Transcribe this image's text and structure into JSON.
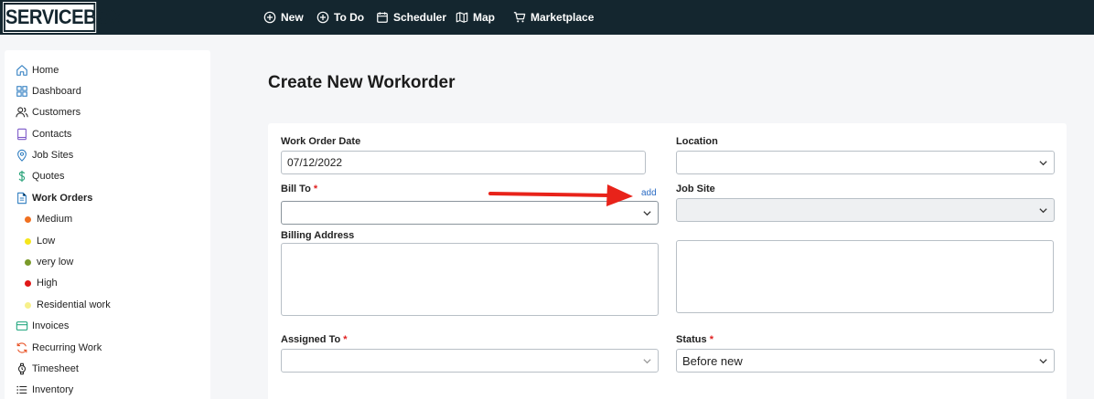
{
  "app": {
    "logo": "SERVICEBOX"
  },
  "topnav": [
    {
      "label": "New",
      "icon": "plus-circle-icon"
    },
    {
      "label": "To Do",
      "icon": "plus-circle-icon"
    },
    {
      "label": "Scheduler",
      "icon": "calendar-icon"
    },
    {
      "label": "Map",
      "icon": "map-icon"
    },
    {
      "label": "Marketplace",
      "icon": "cart-icon"
    }
  ],
  "sidebar": {
    "items": [
      {
        "label": "Home",
        "icon": "home-icon"
      },
      {
        "label": "Dashboard",
        "icon": "dashboard-icon"
      },
      {
        "label": "Customers",
        "icon": "users-icon"
      },
      {
        "label": "Contacts",
        "icon": "book-icon"
      },
      {
        "label": "Job Sites",
        "icon": "pin-icon"
      },
      {
        "label": "Quotes",
        "icon": "dollar-icon"
      },
      {
        "label": "Work Orders",
        "icon": "document-icon"
      },
      {
        "label": "Invoices",
        "icon": "card-icon"
      },
      {
        "label": "Recurring Work",
        "icon": "recurring-icon"
      },
      {
        "label": "Timesheet",
        "icon": "watch-icon"
      },
      {
        "label": "Inventory",
        "icon": "list-icon"
      }
    ],
    "work_order_types": [
      {
        "label": "Medium",
        "color": "#f07020"
      },
      {
        "label": "Low",
        "color": "#f5e61c"
      },
      {
        "label": "very low",
        "color": "#7a9a2a"
      },
      {
        "label": "High",
        "color": "#e01818"
      },
      {
        "label": "Residential work",
        "color": "#f7f08a"
      }
    ]
  },
  "main": {
    "title": "Create New Workorder",
    "form": {
      "work_order_date_label": "Work Order Date",
      "work_order_date_value": "07/12/2022",
      "location_label": "Location",
      "location_value": "",
      "bill_to_label": "Bill To",
      "bill_to_value": "",
      "add_link": "add",
      "job_site_label": "Job Site",
      "job_site_value": "",
      "billing_address_label": "Billing Address",
      "assigned_to_label": "Assigned To",
      "assigned_to_value": "",
      "status_label": "Status",
      "status_value": "Before new",
      "required_marker": "*"
    }
  },
  "colors": {
    "topbar": "#14262f",
    "accent_link": "#2b6cc4",
    "required": "#e02020",
    "annotation_arrow": "#e8231a"
  }
}
